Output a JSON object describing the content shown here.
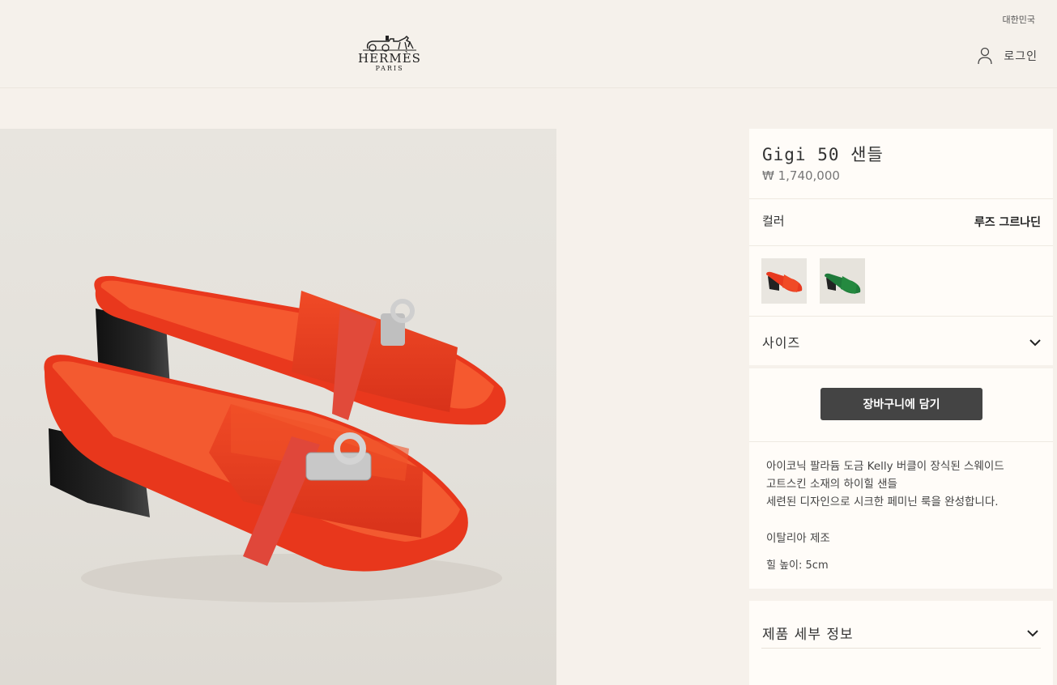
{
  "header": {
    "brand": "HERMÈS",
    "brand_sub": "PARIS",
    "region": "대한민국",
    "login_label": "로그인"
  },
  "product": {
    "title": "Gigi 50 샌들",
    "price": "₩ 1,740,000",
    "color_label": "컬러",
    "color_value": "루즈 그르나딘",
    "swatches": [
      {
        "name": "red",
        "color": "#e8391f",
        "selected": true
      },
      {
        "name": "green",
        "color": "#1f7a3a",
        "selected": false
      }
    ],
    "size_label": "사이즈",
    "cart_button": "장바구니에 담기",
    "description": [
      "아이코닉 팔라듐 도금 Kelly 버클이 장식된 스웨이드",
      "고트스킨 소재의 하이힐 샌들",
      "세련된 디자인으로 시크한 페미닌 룩을 완성합니다."
    ],
    "made_in": "이탈리아 제조",
    "heel_height": "힐 높이: 5cm",
    "details_label": "제품 세부 정보"
  },
  "colors": {
    "background": "#f6f1eb",
    "panel": "#fffcf8",
    "button": "#444444",
    "product_red": "#e8391f"
  }
}
